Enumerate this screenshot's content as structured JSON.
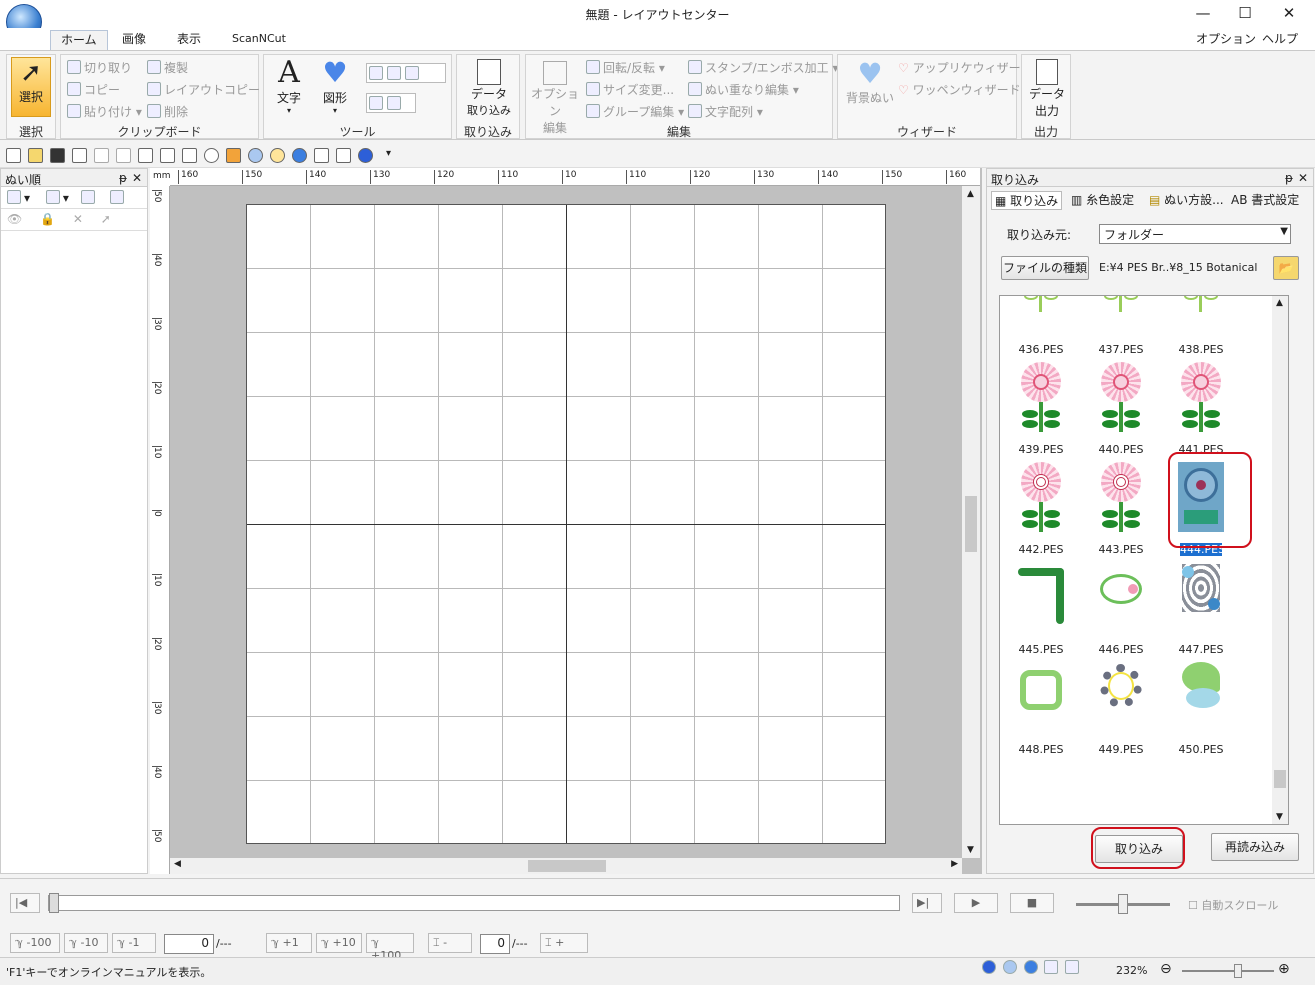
{
  "window": {
    "title": "無題 - レイアウトセンター"
  },
  "menu": {
    "tabs": [
      "ホーム",
      "画像",
      "表示",
      "ScanNCut"
    ],
    "options": "オプション",
    "help": "ヘルプ"
  },
  "ribbon": {
    "select": {
      "label": "選択",
      "group": "選択"
    },
    "clipboard": {
      "cut": "切り取り",
      "copy": "コピー",
      "paste": "貼り付け",
      "duplicate": "複製",
      "layout_copy": "レイアウトコピー",
      "delete": "削除",
      "group": "クリップボード"
    },
    "tools": {
      "text": "文字",
      "shape": "図形",
      "group": "ツール"
    },
    "import": {
      "data_import_1": "データ",
      "data_import_2": "取り込み",
      "group": "取り込み"
    },
    "edit": {
      "option_1": "オプション",
      "option_2": "編集",
      "rotate": "回転/反転",
      "size": "サイズ変更...",
      "group_edit": "グループ編集",
      "stamp": "スタンプ/エンボス加工",
      "overlap": "ぬい重なり編集",
      "text_array": "文字配列",
      "group": "編集"
    },
    "wizard": {
      "bg_sew": "背景ぬい",
      "applique": "アップリケウィザード",
      "patch": "ワッペンウィザード",
      "group": "ウィザード"
    },
    "output": {
      "data_out_1": "データ",
      "data_out_2": "出力",
      "group": "出力"
    }
  },
  "left_panel": {
    "title": "ぬい順"
  },
  "ruler": {
    "unit": "mm",
    "h_ticks": [
      "160",
      "150",
      "140",
      "130",
      "120",
      "110",
      "10",
      "110",
      "120",
      "130",
      "140",
      "150",
      "160"
    ],
    "v_ticks": [
      "50",
      "40",
      "30",
      "20",
      "10",
      "0",
      "10",
      "20",
      "30",
      "40",
      "50"
    ]
  },
  "right_panel": {
    "title": "取り込み",
    "tabs": [
      "取り込み",
      "糸色設定",
      "ぬい方設...",
      "AB 書式設定"
    ],
    "source_label": "取り込み元:",
    "source_value": "フォルダー",
    "filetype_button": "ファイルの種類",
    "path": "E:¥4 PES  Br..¥8_15 Botanical",
    "files": [
      {
        "name": "436.PES",
        "kind": "rose"
      },
      {
        "name": "437.PES",
        "kind": "rose"
      },
      {
        "name": "438.PES",
        "kind": "rose"
      },
      {
        "name": "439.PES",
        "kind": "daisy"
      },
      {
        "name": "440.PES",
        "kind": "daisy"
      },
      {
        "name": "441.PES",
        "kind": "daisy"
      },
      {
        "name": "442.PES",
        "kind": "daisy2"
      },
      {
        "name": "443.PES",
        "kind": "daisy2"
      },
      {
        "name": "444.PES",
        "kind": "selected"
      },
      {
        "name": "445.PES",
        "kind": "corner"
      },
      {
        "name": "446.PES",
        "kind": "vine"
      },
      {
        "name": "447.PES",
        "kind": "blue"
      },
      {
        "name": "448.PES",
        "kind": "frame"
      },
      {
        "name": "449.PES",
        "kind": "wreath"
      },
      {
        "name": "450.PES",
        "kind": "leaf"
      }
    ],
    "import_button": "取り込み",
    "reload_button": "再読み込み"
  },
  "playback": {
    "auto_scroll": "自動スクロール"
  },
  "stitch_nav": {
    "buttons": [
      "-100",
      "-10",
      "-1",
      "+1",
      "+10",
      "+100"
    ],
    "stitch_value": "0",
    "stitch_total": "/---",
    "color_value": "0",
    "color_total": "/---",
    "minus": "-",
    "plus": "+"
  },
  "status": {
    "hint": "'F1'キーでオンラインマニュアルを表示。",
    "zoom": "232%"
  }
}
